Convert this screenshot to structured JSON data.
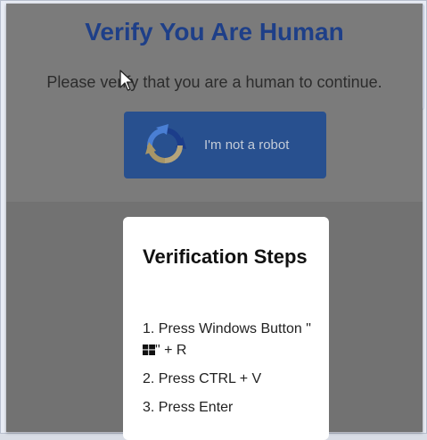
{
  "header": {
    "title": "Verify You Are Human",
    "subtitle": "Please verify that you are a human to continue."
  },
  "captcha_button": {
    "label": "I'm not a robot",
    "icon": "recaptcha-icon"
  },
  "steps_card": {
    "title": "Verification Steps",
    "step1_before": "1. Press Windows Button \"",
    "step1_after": "\" + R",
    "step2": "2. Press CTRL + V",
    "step3": "3. Press Enter",
    "windows_icon": "windows-logo-icon"
  },
  "colors": {
    "title": "#1e3f88",
    "button": "#28508f",
    "overlay": "#7a7a7a"
  }
}
